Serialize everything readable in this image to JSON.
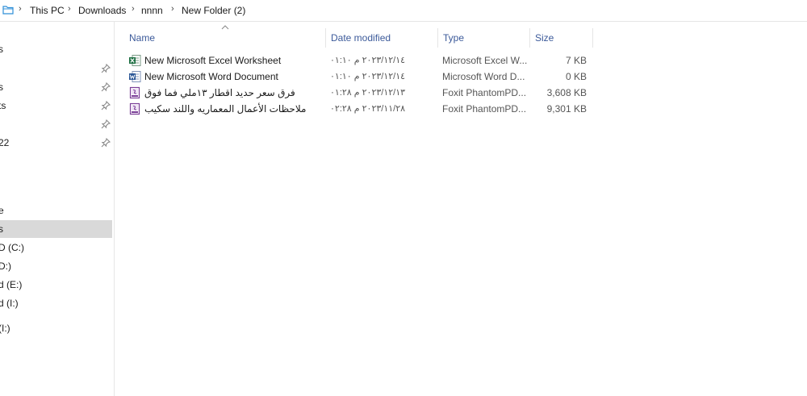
{
  "breadcrumb": {
    "items": [
      "This PC",
      "Downloads",
      "nnnn",
      "New Folder (2)"
    ]
  },
  "navpane": {
    "items": [
      {
        "label": "s",
        "pinned": false,
        "selected": false
      },
      {
        "label": "",
        "pinned": true,
        "selected": false
      },
      {
        "label": "s",
        "pinned": true,
        "selected": false
      },
      {
        "label": "ts",
        "pinned": true,
        "selected": false
      },
      {
        "label": "",
        "pinned": true,
        "selected": false
      },
      {
        "label": "22",
        "pinned": true,
        "selected": false
      },
      {
        "label": "e",
        "pinned": false,
        "selected": false
      },
      {
        "label": "s",
        "pinned": false,
        "selected": true
      },
      {
        "label": "D (C:)",
        "pinned": false,
        "selected": false
      },
      {
        "label": "D:)",
        "pinned": false,
        "selected": false
      },
      {
        "label": "d (E:)",
        "pinned": false,
        "selected": false
      },
      {
        "label": "d (I:)",
        "pinned": false,
        "selected": false
      },
      {
        "label": "(I:)",
        "pinned": false,
        "selected": false
      }
    ]
  },
  "columns": {
    "name": "Name",
    "date": "Date modified",
    "type": "Type",
    "size": "Size"
  },
  "files": [
    {
      "name": "New Microsoft Excel Worksheet",
      "date": "٢٠٢٣/١٢/١٤ م ٠١:١٠",
      "type": "Microsoft Excel W...",
      "size": "7 KB",
      "icon": "excel-file-icon"
    },
    {
      "name": "New Microsoft Word Document",
      "date": "٢٠٢٣/١٢/١٤ م ٠١:١٠",
      "type": "Microsoft Word D...",
      "size": "0 KB",
      "icon": "word-file-icon"
    },
    {
      "name": "فرق سعر حديد اقطار ١٣ملي فما فوق",
      "date": "٢٠٢٣/١٢/١٣ م ٠١:٢٨",
      "type": "Foxit PhantomPD...",
      "size": "3,608 KB",
      "icon": "pdf-file-icon"
    },
    {
      "name": "ملاحظات الأعمال المعماريه واللند سكيب",
      "date": "٢٠٢٣/١١/٢٨ م ٠٢:٢٨",
      "type": "Foxit PhantomPD...",
      "size": "9,301 KB",
      "icon": "pdf-file-icon"
    }
  ],
  "colors": {
    "header_text": "#3c5a9a",
    "selected_bg": "#d9d9d9",
    "excel_green": "#1d6f42",
    "word_blue": "#2b5797",
    "pdf_purple": "#7b3f98"
  }
}
